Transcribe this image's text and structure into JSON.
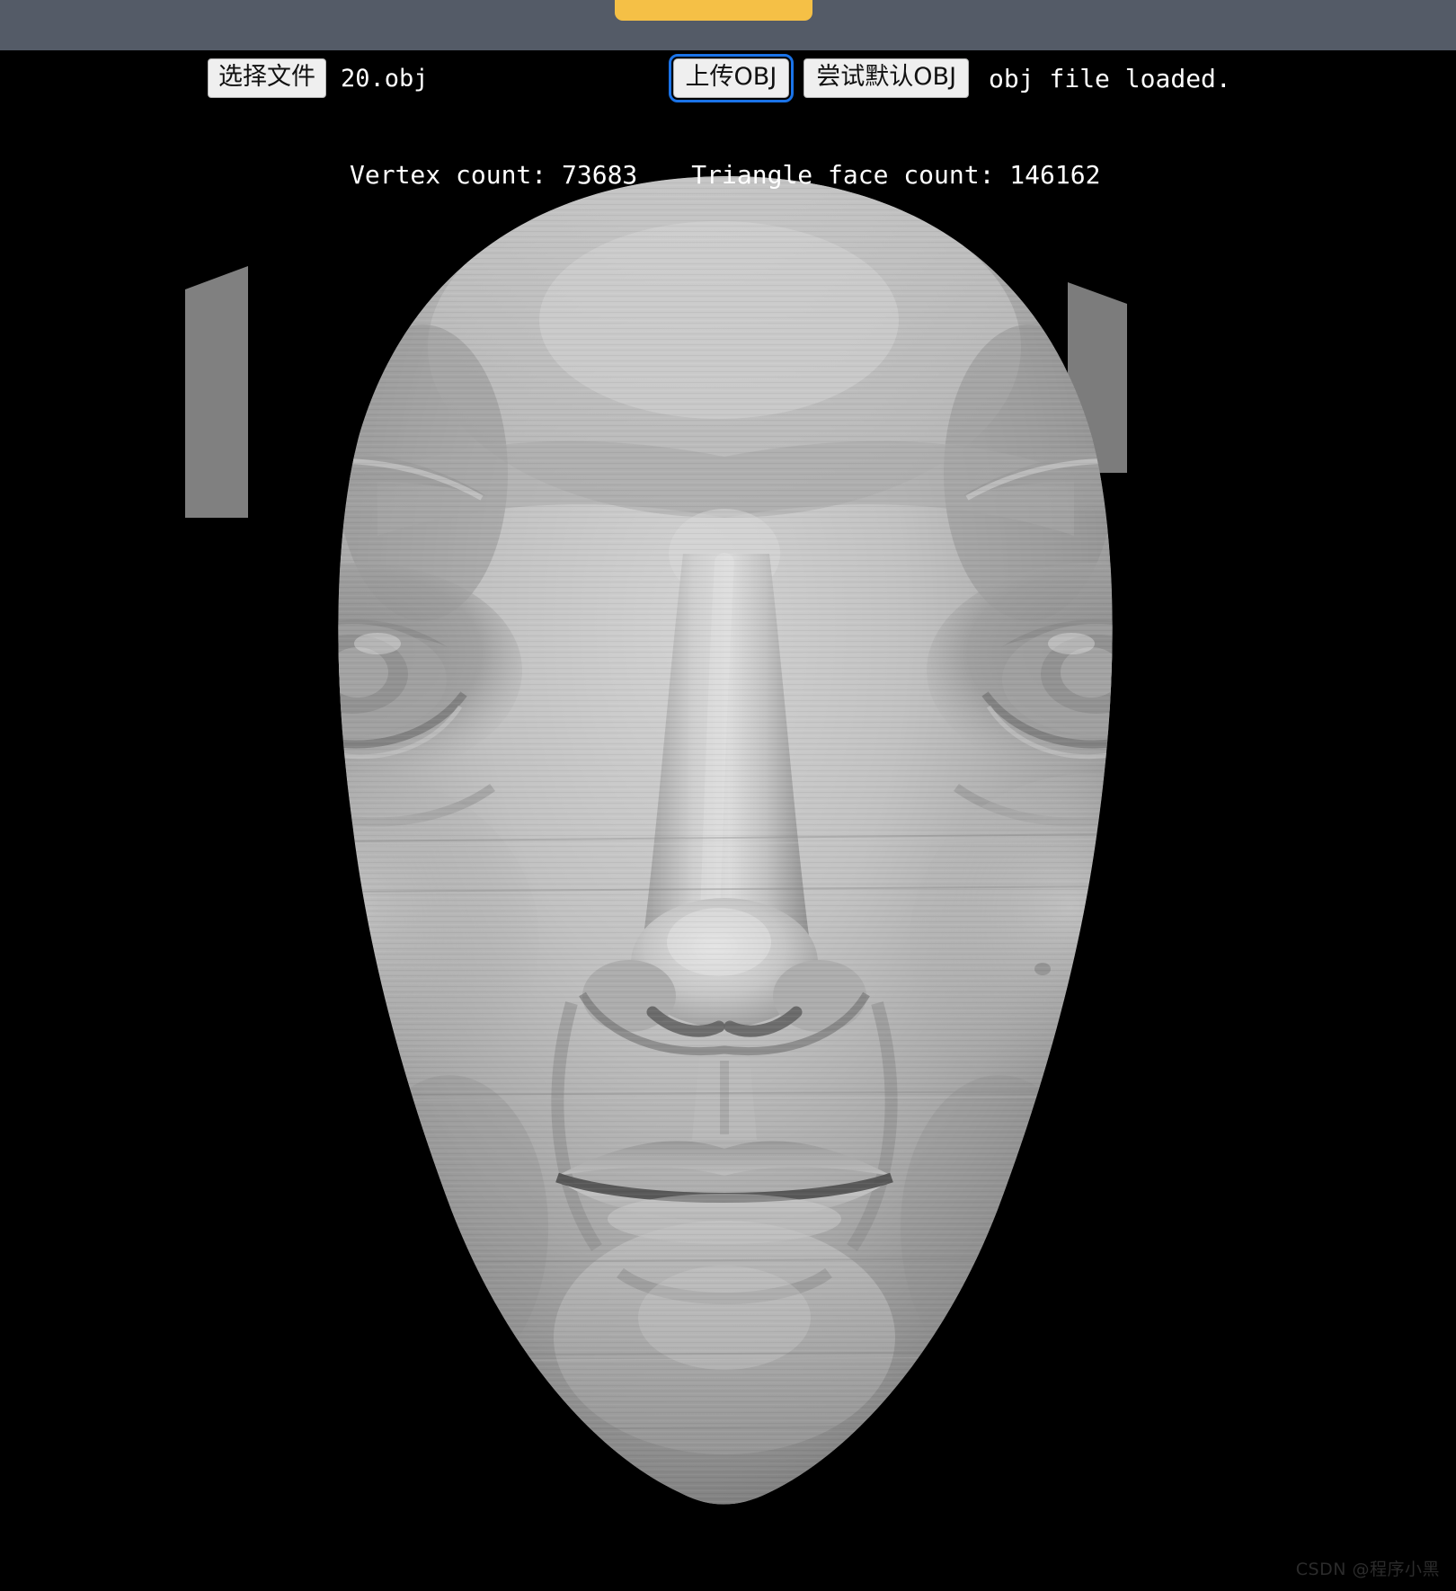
{
  "browser": {
    "tab_color": "#f5c046",
    "chrome_color": "#545b67"
  },
  "controls": {
    "file_select_label": "选择文件",
    "file_name": "20.obj",
    "upload_button_label": "上传OBJ",
    "default_obj_button_label": "尝试默认OBJ",
    "status_message": "obj file loaded.",
    "focus_ring_color": "#1a73e8"
  },
  "stats": {
    "vertex_label": "Vertex count: 73683",
    "triangle_label": "Triangle face count: 146162",
    "vertex_count": 73683,
    "triangle_face_count": 146162
  },
  "viewer": {
    "background_color": "#000000",
    "model_name": "20.obj",
    "render_description": "3D scanned human face mesh, front view, flat gray shading"
  },
  "watermark": {
    "text": "CSDN @程序小黑"
  }
}
